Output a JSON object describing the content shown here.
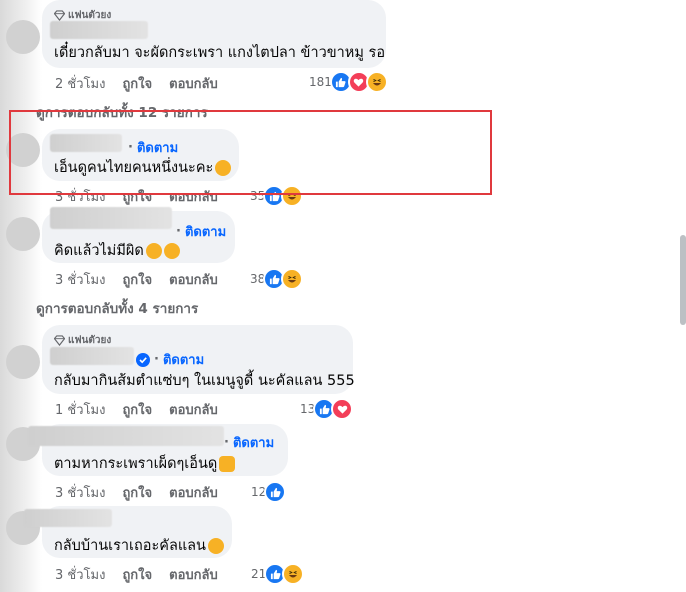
{
  "comments": [
    {
      "badge": "แฟนตัวยง",
      "text": "เดี๋ยวกลับมา จะผัดกระเพรา แกงไตปลา ข้าวขาหมู รอ",
      "time": "2 ชั่วโมง",
      "like": "ถูกใจ",
      "reply": "ตอบกลับ",
      "count": "181",
      "reactions": [
        "like-icon",
        "love-icon",
        "haha-icon"
      ]
    },
    {
      "follow": "ติดตาม",
      "text": "เอ็นดูคนไทยคนหนึ่งนะคะ",
      "time": "3 ชั่วโมง",
      "like": "ถูกใจ",
      "reply": "ตอบกลับ",
      "count": "35",
      "reactions": [
        "like-icon",
        "haha-icon"
      ]
    },
    {
      "follow": "ติดตาม",
      "text": "คิดแล้วไม่มีผิด",
      "time": "3 ชั่วโมง",
      "like": "ถูกใจ",
      "reply": "ตอบกลับ",
      "count": "38",
      "reactions": [
        "like-icon",
        "haha-icon"
      ]
    },
    {
      "badge": "แฟนตัวยง",
      "follow": "ติดตาม",
      "text": "กลับมากินส้มตำแซ่บๆ ในเมนูจูดี้ นะคัลแลน 555",
      "time": "1 ชั่วโมง",
      "like": "ถูกใจ",
      "reply": "ตอบกลับ",
      "count": "13",
      "reactions": [
        "like-icon",
        "love-icon"
      ]
    },
    {
      "follow": "ติดตาม",
      "text": "ตามหากระเพราเผ็ดๆเอ็นดู",
      "time": "3 ชั่วโมง",
      "like": "ถูกใจ",
      "reply": "ตอบกลับ",
      "count": "12",
      "reactions": [
        "like-icon"
      ]
    },
    {
      "text": "กลับบ้านเราเถอะคัลแลน",
      "time": "3 ชั่วโมง",
      "like": "ถูกใจ",
      "reply": "ตอบกลับ",
      "count": "21",
      "reactions": [
        "like-icon",
        "haha-icon"
      ]
    }
  ],
  "view_replies": [
    "ดูการตอบกลับทั้ง 12 รายการ",
    "ดูการตอบกลับทั้ง 4 รายการ"
  ],
  "colors": {
    "link_blue": "#0866ff",
    "highlight_red": "#e0393e",
    "bubble_bg": "#f0f2f5",
    "muted_text": "#65676b"
  }
}
